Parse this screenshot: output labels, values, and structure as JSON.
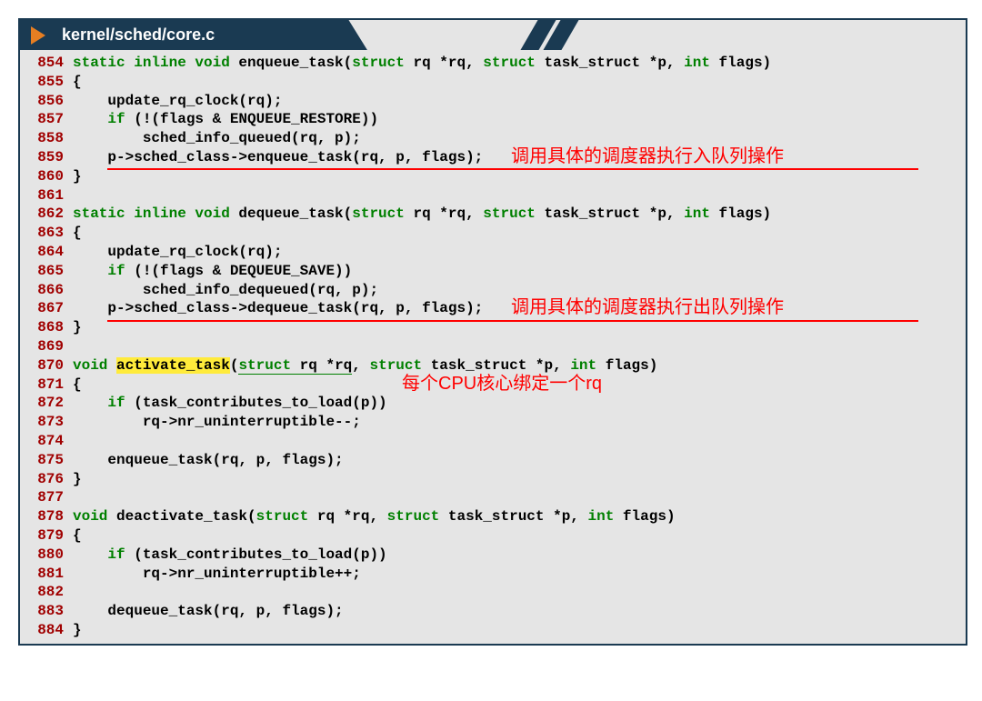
{
  "title": "kernel/sched/core.c",
  "lines": [
    {
      "n": "854",
      "tokens": [
        {
          "t": "static inline void",
          "c": "kw"
        },
        {
          "t": " enqueue_task(",
          "c": "plain"
        },
        {
          "t": "struct",
          "c": "kw"
        },
        {
          "t": " rq *rq, ",
          "c": "plain"
        },
        {
          "t": "struct",
          "c": "kw"
        },
        {
          "t": " task_struct *p, ",
          "c": "plain"
        },
        {
          "t": "int",
          "c": "kw"
        },
        {
          "t": " flags)",
          "c": "plain"
        }
      ]
    },
    {
      "n": "855",
      "tokens": [
        {
          "t": "{",
          "c": "plain"
        }
      ]
    },
    {
      "n": "856",
      "tokens": [
        {
          "t": "    update_rq_clock(rq);",
          "c": "plain"
        }
      ]
    },
    {
      "n": "857",
      "tokens": [
        {
          "t": "    ",
          "c": "plain"
        },
        {
          "t": "if",
          "c": "kw"
        },
        {
          "t": " (!(flags & ENQUEUE_RESTORE))",
          "c": "plain"
        }
      ]
    },
    {
      "n": "858",
      "tokens": [
        {
          "t": "        sched_info_queued(rq, p);",
          "c": "plain"
        }
      ]
    },
    {
      "n": "859",
      "tokens": [
        {
          "t": "    p->sched_class->enqueue_task(rq, p, flags);",
          "c": "plain"
        }
      ]
    },
    {
      "n": "860",
      "tokens": [
        {
          "t": "}",
          "c": "plain"
        }
      ]
    },
    {
      "n": "861",
      "tokens": [
        {
          "t": "",
          "c": "plain"
        }
      ]
    },
    {
      "n": "862",
      "tokens": [
        {
          "t": "static inline void",
          "c": "kw"
        },
        {
          "t": " dequeue_task(",
          "c": "plain"
        },
        {
          "t": "struct",
          "c": "kw"
        },
        {
          "t": " rq *rq, ",
          "c": "plain"
        },
        {
          "t": "struct",
          "c": "kw"
        },
        {
          "t": " task_struct *p, ",
          "c": "plain"
        },
        {
          "t": "int",
          "c": "kw"
        },
        {
          "t": " flags)",
          "c": "plain"
        }
      ]
    },
    {
      "n": "863",
      "tokens": [
        {
          "t": "{",
          "c": "plain"
        }
      ]
    },
    {
      "n": "864",
      "tokens": [
        {
          "t": "    update_rq_clock(rq);",
          "c": "plain"
        }
      ]
    },
    {
      "n": "865",
      "tokens": [
        {
          "t": "    ",
          "c": "plain"
        },
        {
          "t": "if",
          "c": "kw"
        },
        {
          "t": " (!(flags & DEQUEUE_SAVE))",
          "c": "plain"
        }
      ]
    },
    {
      "n": "866",
      "tokens": [
        {
          "t": "        sched_info_dequeued(rq, p);",
          "c": "plain"
        }
      ]
    },
    {
      "n": "867",
      "tokens": [
        {
          "t": "    p->sched_class->dequeue_task(rq, p, flags);",
          "c": "plain"
        }
      ]
    },
    {
      "n": "868",
      "tokens": [
        {
          "t": "}",
          "c": "plain"
        }
      ]
    },
    {
      "n": "869",
      "tokens": [
        {
          "t": "",
          "c": "plain"
        }
      ]
    },
    {
      "n": "870",
      "tokens": [
        {
          "t": "void",
          "c": "kw"
        },
        {
          "t": " ",
          "c": "plain"
        },
        {
          "t": "activate_task",
          "c": "plain hl"
        },
        {
          "t": "(",
          "c": "plain"
        },
        {
          "t": "struct",
          "c": "kw underline-green"
        },
        {
          "t": " rq *rq",
          "c": "plain underline-green"
        },
        {
          "t": ", ",
          "c": "plain"
        },
        {
          "t": "struct",
          "c": "kw"
        },
        {
          "t": " task_struct *p, ",
          "c": "plain"
        },
        {
          "t": "int",
          "c": "kw"
        },
        {
          "t": " flags)",
          "c": "plain"
        }
      ]
    },
    {
      "n": "871",
      "tokens": [
        {
          "t": "{",
          "c": "plain"
        }
      ]
    },
    {
      "n": "872",
      "tokens": [
        {
          "t": "    ",
          "c": "plain"
        },
        {
          "t": "if",
          "c": "kw"
        },
        {
          "t": " (task_contributes_to_load(p))",
          "c": "plain"
        }
      ]
    },
    {
      "n": "873",
      "tokens": [
        {
          "t": "        rq->nr_uninterruptible--;",
          "c": "plain"
        }
      ]
    },
    {
      "n": "874",
      "tokens": [
        {
          "t": "",
          "c": "plain"
        }
      ]
    },
    {
      "n": "875",
      "tokens": [
        {
          "t": "    enqueue_task(rq, p, flags);",
          "c": "plain"
        }
      ]
    },
    {
      "n": "876",
      "tokens": [
        {
          "t": "}",
          "c": "plain"
        }
      ]
    },
    {
      "n": "877",
      "tokens": [
        {
          "t": "",
          "c": "plain"
        }
      ]
    },
    {
      "n": "878",
      "tokens": [
        {
          "t": "void",
          "c": "kw"
        },
        {
          "t": " deactivate_task(",
          "c": "plain"
        },
        {
          "t": "struct",
          "c": "kw"
        },
        {
          "t": " rq *rq, ",
          "c": "plain"
        },
        {
          "t": "struct",
          "c": "kw"
        },
        {
          "t": " task_struct *p, ",
          "c": "plain"
        },
        {
          "t": "int",
          "c": "kw"
        },
        {
          "t": " flags)",
          "c": "plain"
        }
      ]
    },
    {
      "n": "879",
      "tokens": [
        {
          "t": "{",
          "c": "plain"
        }
      ]
    },
    {
      "n": "880",
      "tokens": [
        {
          "t": "    ",
          "c": "plain"
        },
        {
          "t": "if",
          "c": "kw"
        },
        {
          "t": " (task_contributes_to_load(p))",
          "c": "plain"
        }
      ]
    },
    {
      "n": "881",
      "tokens": [
        {
          "t": "        rq->nr_uninterruptible++;",
          "c": "plain"
        }
      ]
    },
    {
      "n": "882",
      "tokens": [
        {
          "t": "",
          "c": "plain"
        }
      ]
    },
    {
      "n": "883",
      "tokens": [
        {
          "t": "    dequeue_task(rq, p, flags);",
          "c": "plain"
        }
      ]
    },
    {
      "n": "884",
      "tokens": [
        {
          "t": "}",
          "c": "plain"
        }
      ]
    }
  ],
  "annotations": {
    "a1": "调用具体的调度器执行入队列操作",
    "a2": "调用具体的调度器执行出队列操作",
    "a3": "每个CPU核心绑定一个rq"
  }
}
